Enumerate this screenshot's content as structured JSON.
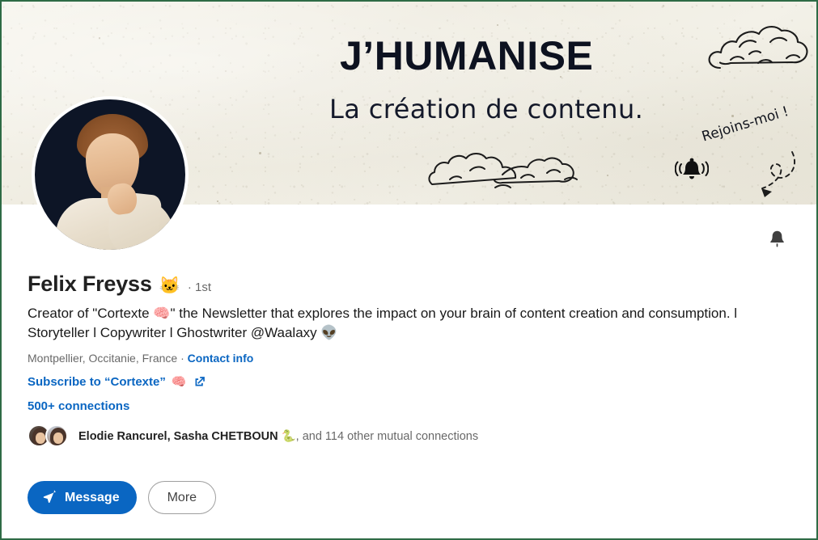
{
  "banner": {
    "title": "J’HUMANISE",
    "subtitle": "La création de contenu.",
    "cta_note": "Rejoins-moi !",
    "background_color": "#f1efe6",
    "title_color": "#0d1220"
  },
  "profile": {
    "name": "Felix Freyss",
    "name_emoji": "🐱",
    "degree": "· 1st",
    "headline": "Creator of \"Cortexte 🧠\" the Newsletter that explores the impact on your brain of content creation and consumption. l Storyteller l Copywriter l Ghostwriter @Waalaxy 👽",
    "location": "Montpellier, Occitanie, France",
    "location_separator": "·",
    "contact_info_label": "Contact info",
    "subscribe_label": "Subscribe to “Cortexte”",
    "subscribe_emoji": "🧠",
    "connections_label": "500+ connections",
    "mutual_names": "Elodie Rancurel, Sasha CHETBOUN 🐍",
    "mutual_suffix": ", and 114 other mutual connections",
    "link_color": "#0a66c2"
  },
  "actions": {
    "message_label": "Message",
    "more_label": "More"
  },
  "icons": {
    "notify_bell": "bell-icon",
    "external_link": "external-link-icon",
    "send": "send-icon"
  }
}
